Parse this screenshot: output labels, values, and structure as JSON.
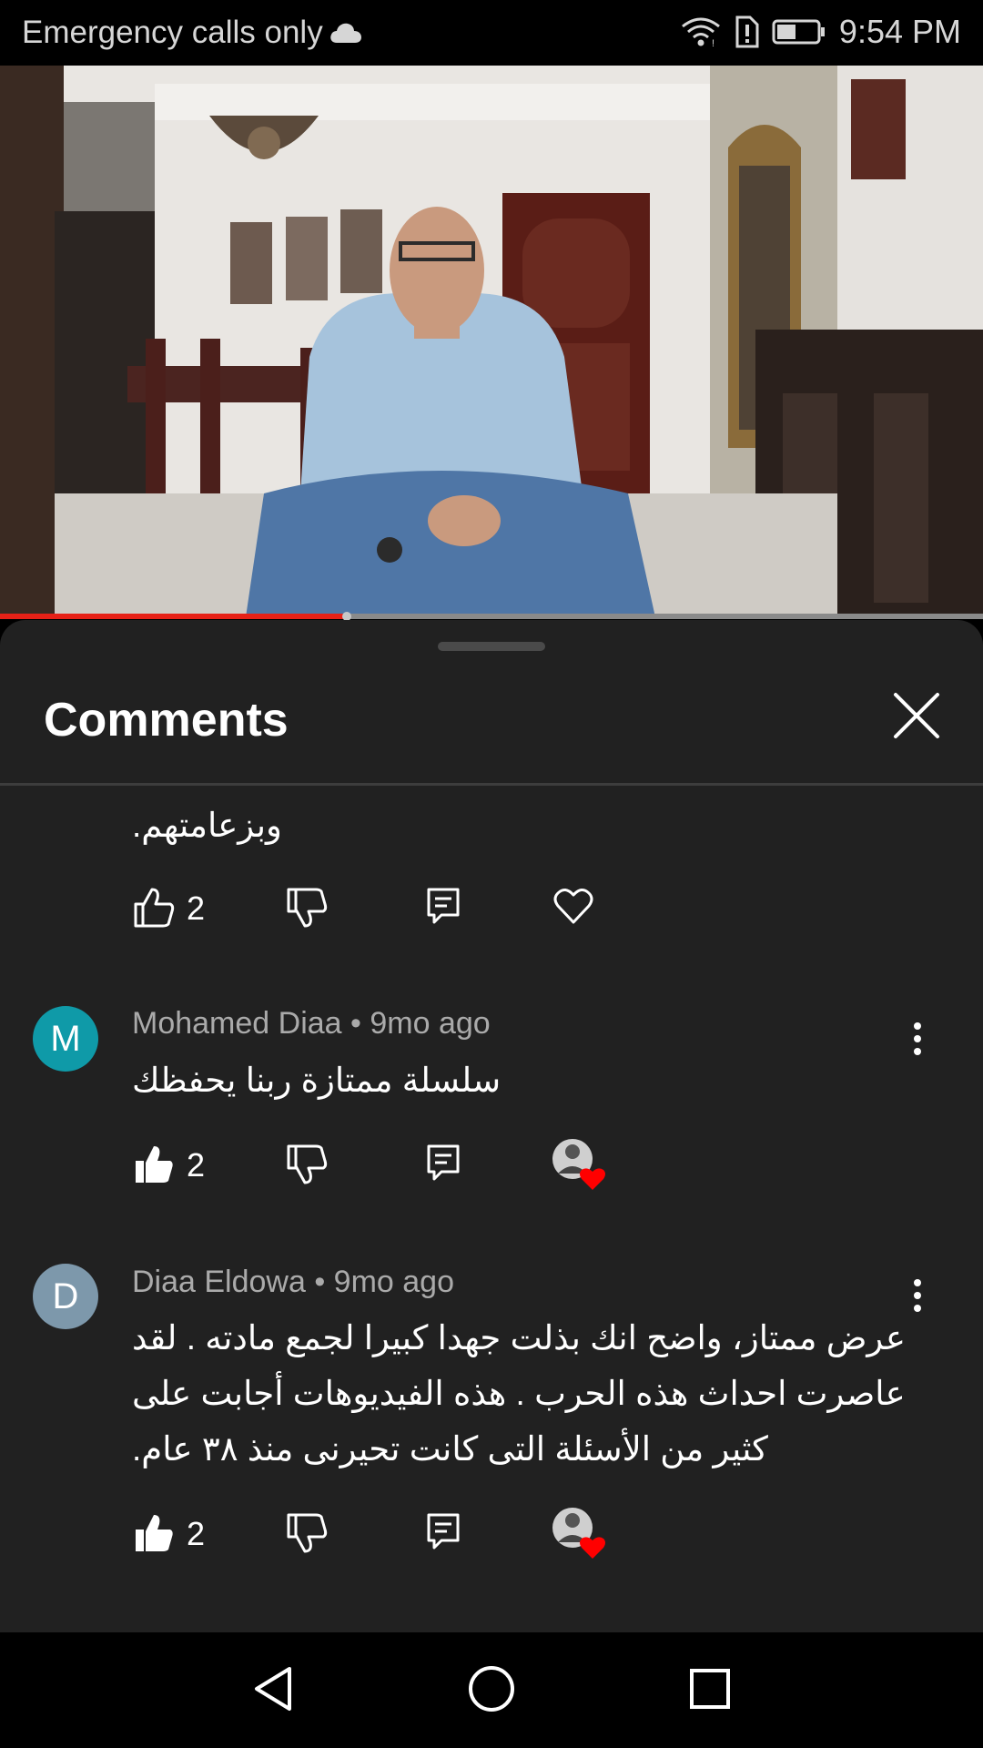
{
  "status_bar": {
    "carrier": "Emergency calls only",
    "time": "9:54 PM",
    "icons": [
      "cloud-icon",
      "wifi-icon",
      "sim-alert-icon",
      "battery-icon"
    ]
  },
  "video": {
    "progress_fraction": 0.35,
    "progress_color": "#e62117"
  },
  "comments_panel": {
    "title": "Comments",
    "close_icon": "close-icon"
  },
  "comments": [
    {
      "text": "وبزعامتهم.",
      "likes": "2",
      "liked": false,
      "hearted_by_creator": false
    },
    {
      "avatar_letter": "M",
      "avatar_color": "#0f9aa8",
      "author": "Mohamed Diaa",
      "age": "9mo ago",
      "meta": "Mohamed Diaa • 9mo ago",
      "text": "سلسلة ممتازة ربنا يحفظك",
      "likes": "2",
      "liked": true,
      "hearted_by_creator": true
    },
    {
      "avatar_letter": "D",
      "avatar_color": "#7d98ab",
      "author": "Diaa Eldowa",
      "age": "9mo ago",
      "meta": "Diaa Eldowa • 9mo ago",
      "text_lines": [
        "عرض ممتاز،  واضح انك بذلت جهدا كبيرا لجمع مادته . لقد",
        "عاصرت احداث هذه الحرب . هذه الفيديوهات أجابت على",
        "كثير من الأسئلة التى كانت تحيرنى منذ ٣٨ عام."
      ],
      "likes": "2",
      "liked": true,
      "hearted_by_creator": true
    }
  ],
  "nav_bar": {
    "buttons": [
      "back-icon",
      "home-icon",
      "recents-icon"
    ]
  }
}
